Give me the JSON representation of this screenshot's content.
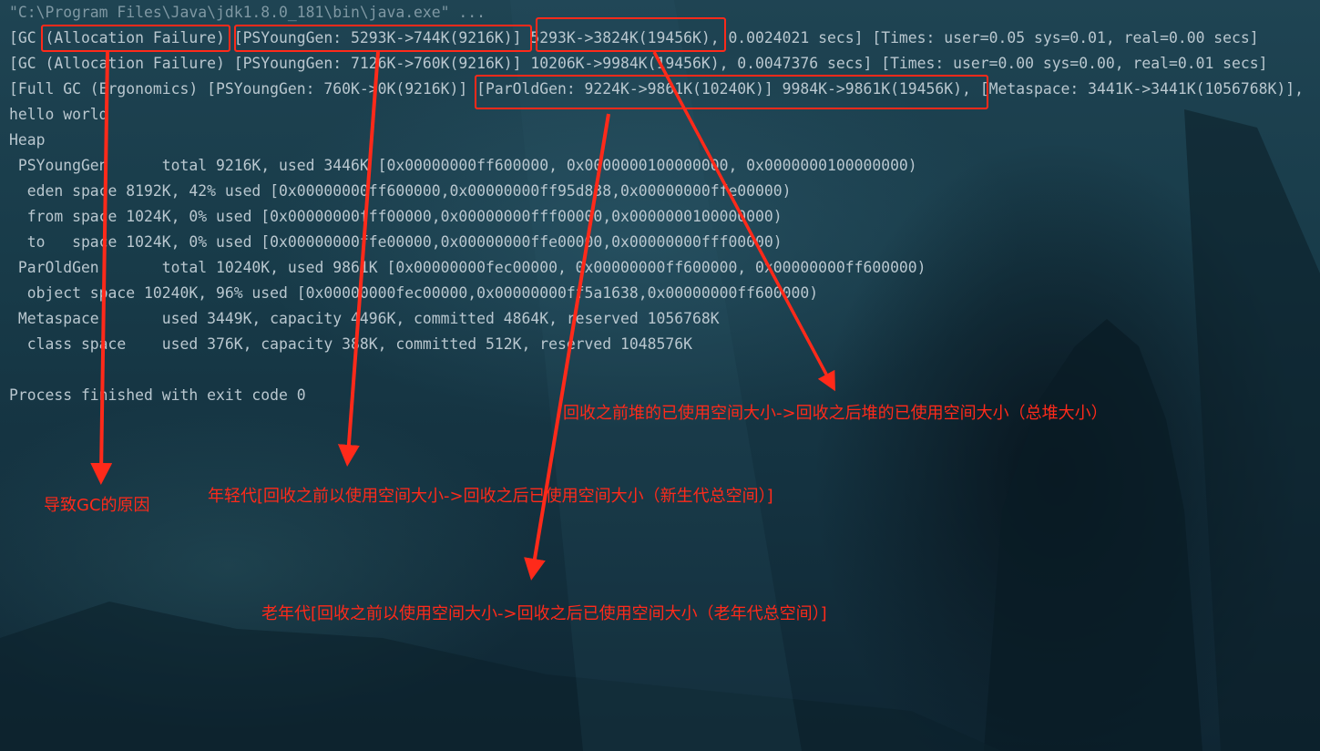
{
  "console": {
    "command": "\"C:\\Program Files\\Java\\jdk1.8.0_181\\bin\\java.exe\" ...",
    "lines": [
      "[GC (Allocation Failure) [PSYoungGen: 5293K->744K(9216K)] 5293K->3824K(19456K), 0.0024021 secs] [Times: user=0.05 sys=0.01, real=0.00 secs]",
      "[GC (Allocation Failure) [PSYoungGen: 7126K->760K(9216K)] 10206K->9984K(19456K), 0.0047376 secs] [Times: user=0.00 sys=0.00, real=0.01 secs]",
      "[Full GC (Ergonomics) [PSYoungGen: 760K->0K(9216K)] [ParOldGen: 9224K->9861K(10240K)] 9984K->9861K(19456K), [Metaspace: 3441K->3441K(1056768K)],",
      "hello world",
      "Heap",
      " PSYoungGen      total 9216K, used 3446K [0x00000000ff600000, 0x0000000100000000, 0x0000000100000000)",
      "  eden space 8192K, 42% used [0x00000000ff600000,0x00000000ff95d838,0x00000000ffe00000)",
      "  from space 1024K, 0% used [0x00000000fff00000,0x00000000fff00000,0x0000000100000000)",
      "  to   space 1024K, 0% used [0x00000000ffe00000,0x00000000ffe00000,0x00000000fff00000)",
      " ParOldGen       total 10240K, used 9861K [0x00000000fec00000, 0x00000000ff600000, 0x00000000ff600000)",
      "  object space 10240K, 96% used [0x00000000fec00000,0x00000000ff5a1638,0x00000000ff600000)",
      " Metaspace       used 3449K, capacity 4496K, committed 4864K, reserved 1056768K",
      "  class space    used 376K, capacity 388K, committed 512K, reserved 1048576K",
      "",
      "Process finished with exit code 0"
    ]
  },
  "annotations": {
    "gc_cause": "导致GC的原因",
    "young_gen": "年轻代[回收之前以使用空间大小->回收之后已使用空间大小（新生代总空间）]",
    "heap_total": "回收之前堆的已使用空间大小->回收之后堆的已使用空间大小（总堆大小）",
    "old_gen": "老年代[回收之前以使用空间大小->回收之后已使用空间大小（老年代总空间）]"
  },
  "colors": {
    "highlight": "#ff2a1a",
    "console_text": "#b9c7cf",
    "background": "#183b49"
  }
}
